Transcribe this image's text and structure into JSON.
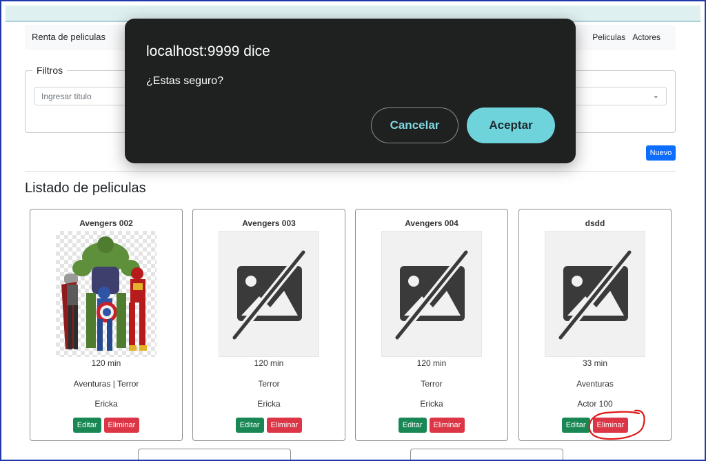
{
  "navbar": {
    "brand": "Renta de peliculas",
    "links": [
      "Peliculas",
      "Actores"
    ]
  },
  "filters": {
    "legend": "Filtros",
    "title_placeholder": "Ingresar titulo",
    "select_icon": "chevron-down-icon"
  },
  "nuevo_label": "Nuevo",
  "list_title": "Listado de peliculas",
  "cards": [
    {
      "title": "Avengers 002",
      "duration": "120 min",
      "genres": "Aventuras | Terror",
      "actor": "Ericka",
      "image": "avengers-heroes-image"
    },
    {
      "title": "Avengers 003",
      "duration": "120 min",
      "genres": "Terror",
      "actor": "Ericka",
      "image": "no-image-icon"
    },
    {
      "title": "Avengers 004",
      "duration": "120 min",
      "genres": "Terror",
      "actor": "Ericka",
      "image": "no-image-icon"
    },
    {
      "title": "dsdd",
      "duration": "33 min",
      "genres": "Aventuras",
      "actor": "Actor 100",
      "image": "no-image-icon"
    }
  ],
  "card_actions": {
    "edit": "Editar",
    "delete": "Eliminar"
  },
  "dialog": {
    "title": "localhost:9999 dice",
    "message": "¿Estas seguro?",
    "cancel": "Cancelar",
    "accept": "Aceptar"
  },
  "colors": {
    "primary": "#0d6efd",
    "success": "#198754",
    "danger": "#dc3545",
    "dialog_bg": "#1f2020",
    "dialog_accent": "#6fd3dc"
  }
}
